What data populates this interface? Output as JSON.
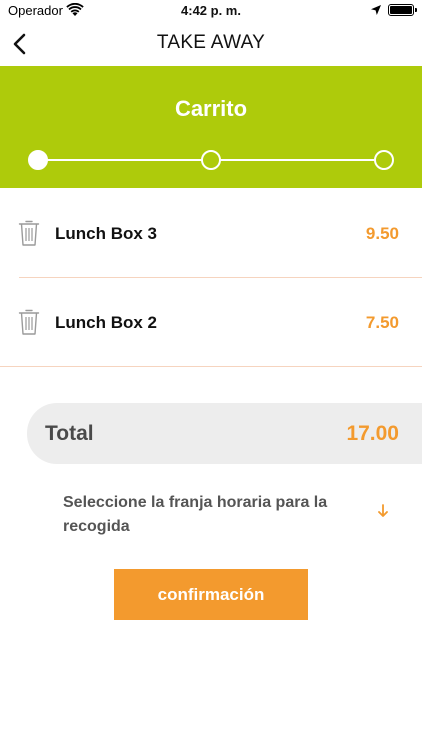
{
  "status_bar": {
    "carrier": "Operador",
    "time": "4:42 p. m."
  },
  "navbar": {
    "title": "TAKE AWAY"
  },
  "cart": {
    "title": "Carrito",
    "steps_total": 3,
    "active_step": 1
  },
  "items": [
    {
      "name": "Lunch Box 3",
      "price": "9.50"
    },
    {
      "name": "Lunch Box 2",
      "price": "7.50"
    }
  ],
  "total": {
    "label": "Total",
    "amount": "17.00"
  },
  "time_slot": {
    "text": "Seleccione la franja horaria para la recogida"
  },
  "confirm_button": {
    "label": "confirmación"
  },
  "colors": {
    "accent_green": "#aecb0b",
    "accent_orange": "#f39a2e",
    "divider": "#f6d4bf",
    "total_bg": "#ededed"
  }
}
